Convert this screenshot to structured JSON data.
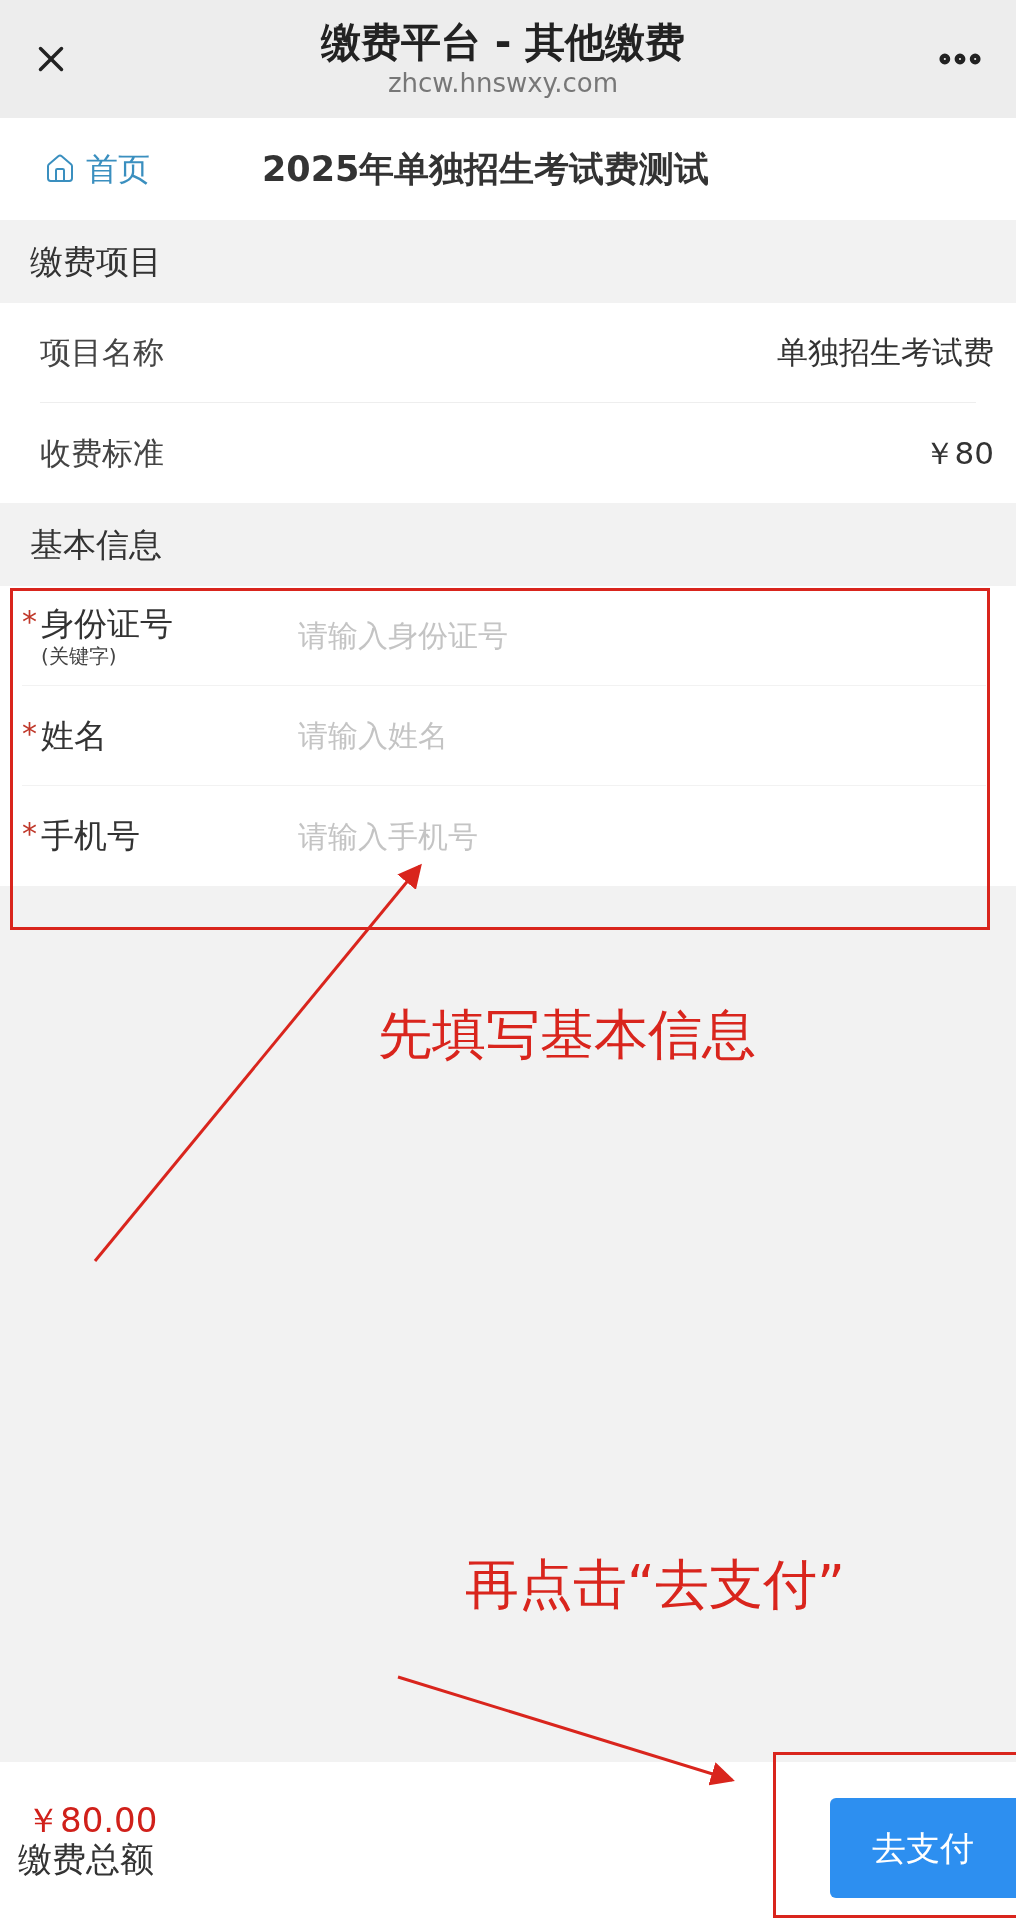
{
  "top_bar": {
    "title": "缴费平台 - 其他缴费",
    "url": "zhcw.hnswxy.com"
  },
  "nav": {
    "home_link": "首页",
    "page_title": "2025年单独招生考试费测试"
  },
  "fee_section": {
    "title": "缴费项目",
    "rows": [
      {
        "label": "项目名称",
        "value": "单独招生考试费"
      },
      {
        "label": "收费标准",
        "value": "￥80"
      }
    ]
  },
  "info_section": {
    "title": "基本信息",
    "fields": [
      {
        "marker": "*",
        "label": "身份证号",
        "sublabel": "(关键字)",
        "placeholder": "请输入身份证号"
      },
      {
        "marker": "*",
        "label": "姓名",
        "placeholder": "请输入姓名"
      },
      {
        "marker": "*",
        "label": "手机号",
        "placeholder": "请输入手机号"
      }
    ]
  },
  "footer": {
    "amount": "￥80.00",
    "amount_label": "缴费总额",
    "pay_button": "去支付"
  },
  "annotations": [
    "先填写基本信息",
    "再点击“去支付”"
  ]
}
